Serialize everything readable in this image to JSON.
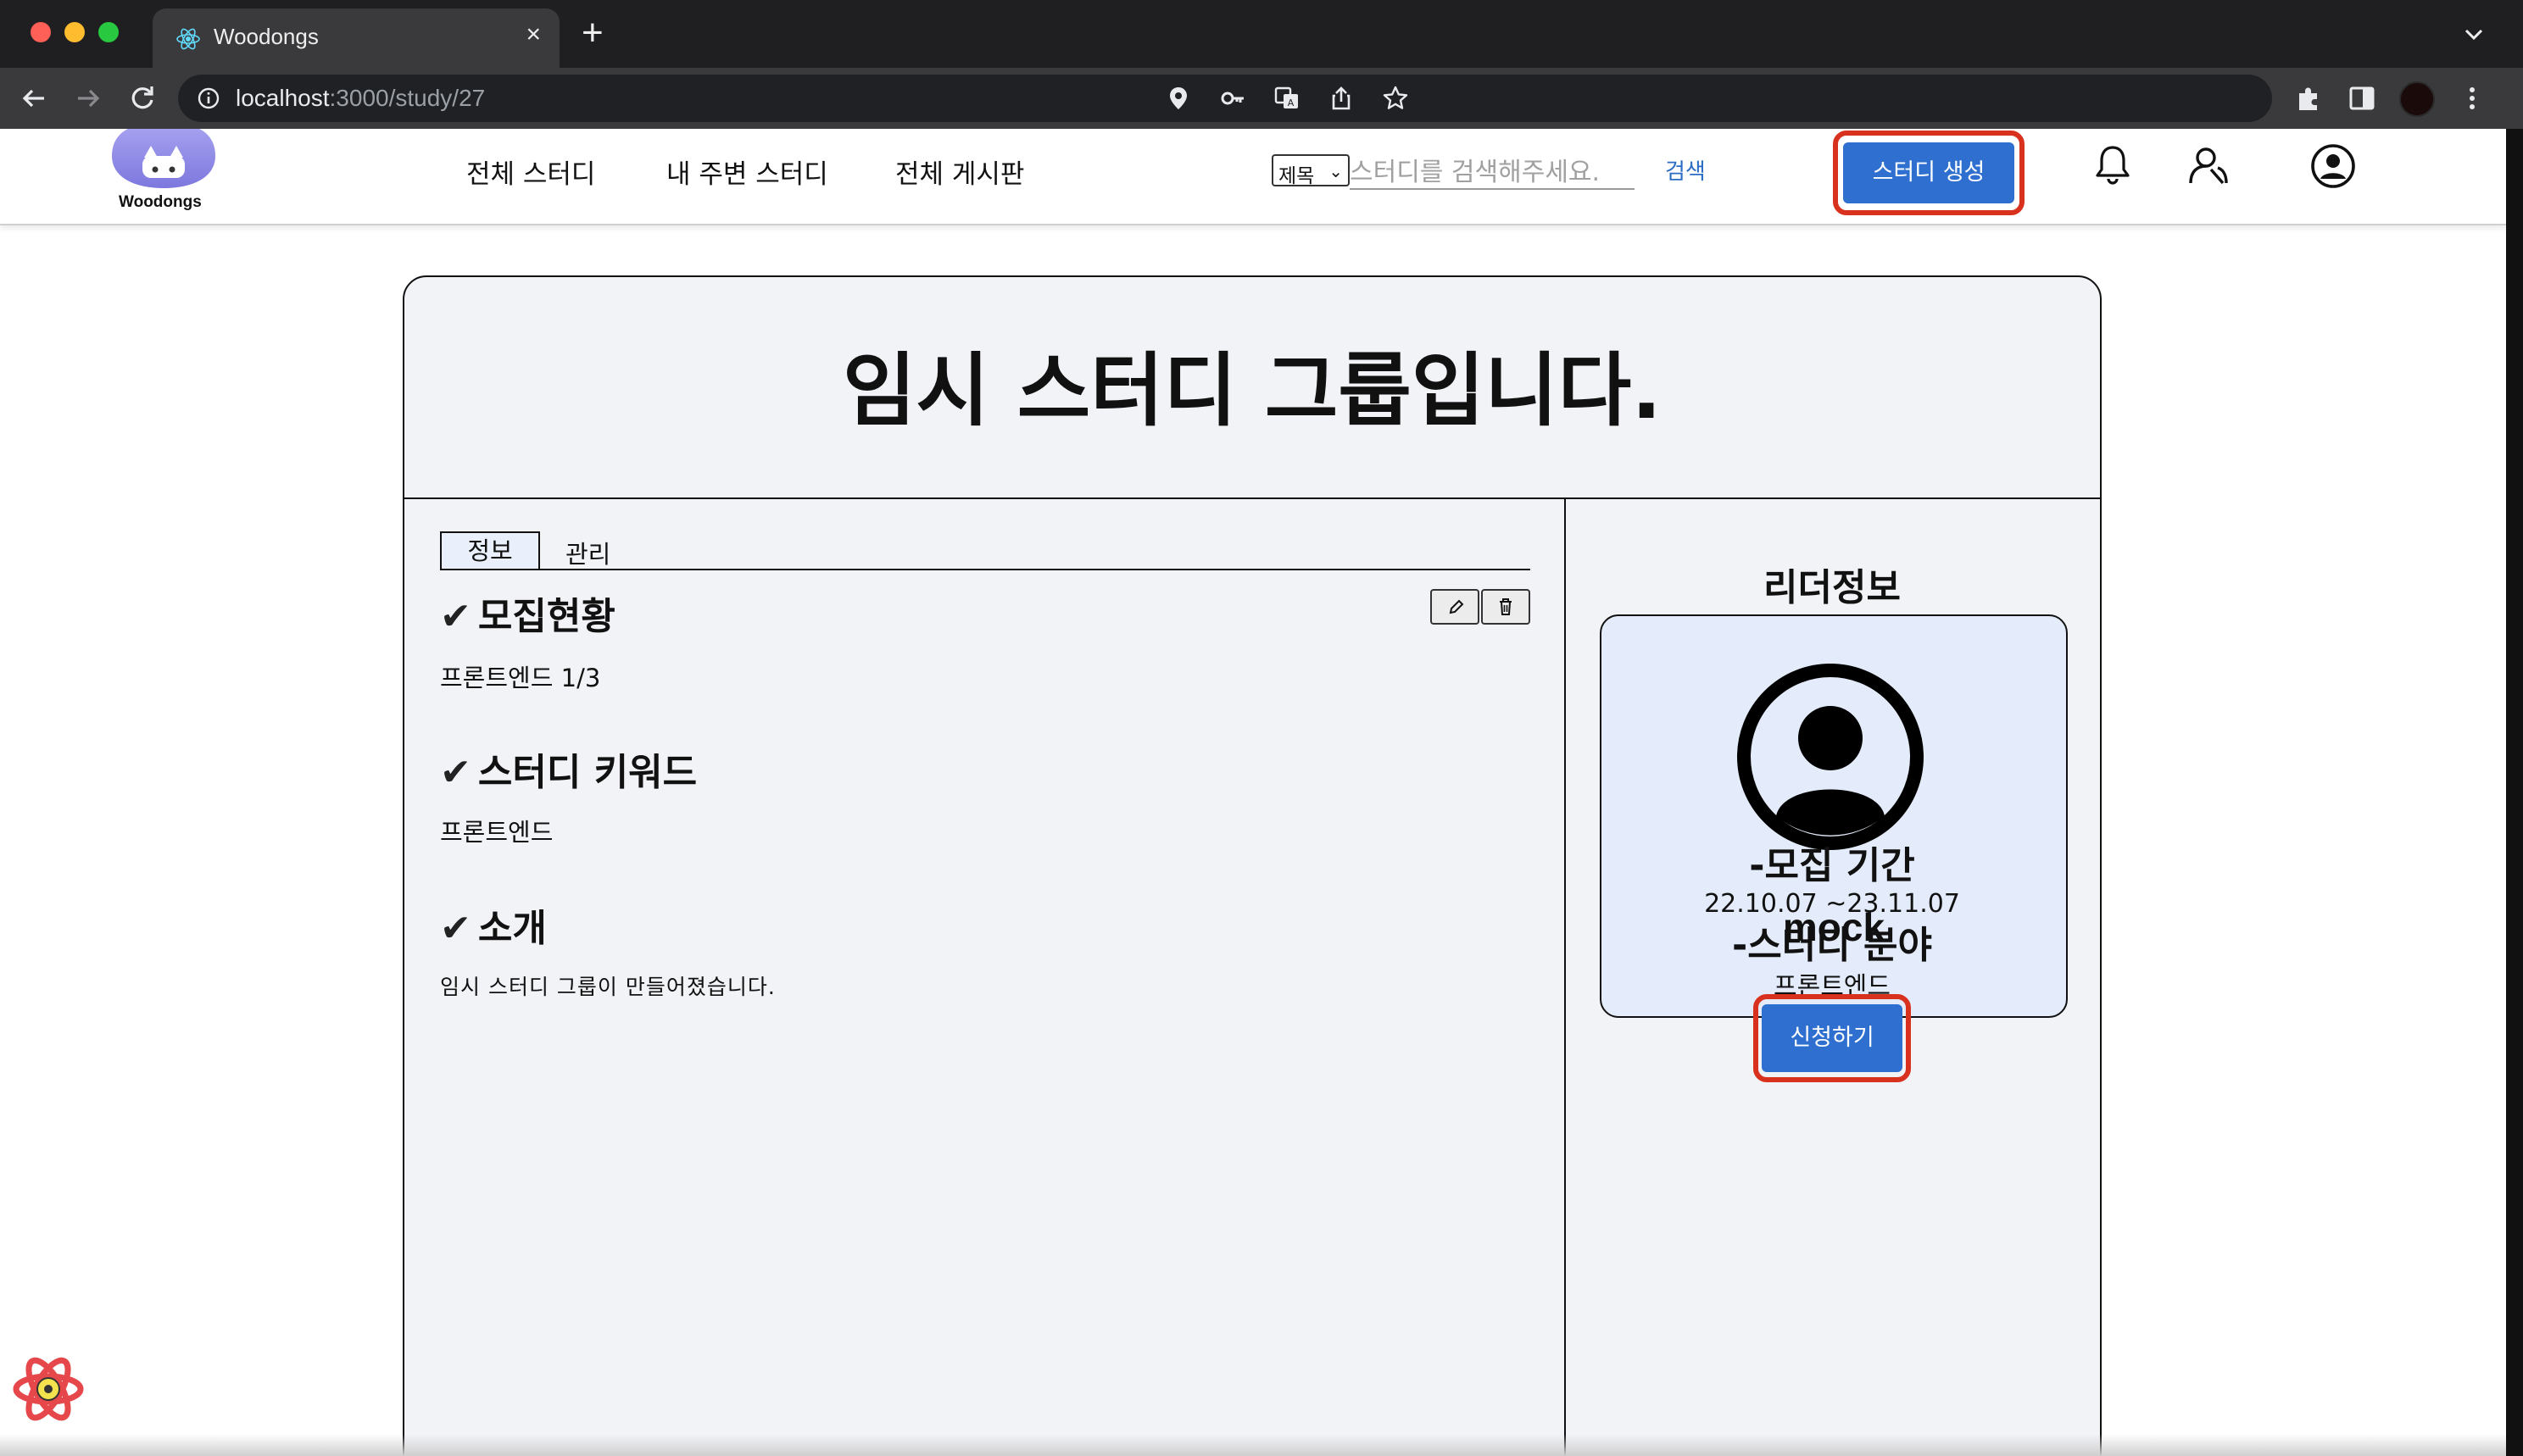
{
  "browser": {
    "tab_title": "Woodongs",
    "url_host": "localhost",
    "url_path": ":3000/study/27",
    "new_tab": "+",
    "close_tab": "×"
  },
  "header": {
    "logo_text": "Woodongs",
    "nav": [
      "전체 스터디",
      "내 주변 스터디",
      "전체 게시판"
    ],
    "search": {
      "select_value": "제목",
      "placeholder": "스터디를 검색해주세요.",
      "button": "검색"
    },
    "create_button": "스터디 생성"
  },
  "study": {
    "title": "임시 스터디 그룹입니다.",
    "tabs": [
      "정보",
      "관리"
    ],
    "sections": [
      {
        "heading": "모집현황",
        "body": "프론트엔드 1/3"
      },
      {
        "heading": "스터디 키워드",
        "body": "프론트엔드"
      },
      {
        "heading": "소개",
        "body": "임시 스터디 그룹이 만들어졌습니다."
      }
    ],
    "check_mark": "✔",
    "leader": {
      "heading": "리더정보",
      "name": "mock"
    },
    "period": {
      "heading": "-모집 기간",
      "value": "22.10.07 ~23.11.07"
    },
    "field": {
      "heading": "-스터디 분야",
      "value": "프론트엔드"
    },
    "apply_button": "신청하기"
  },
  "colors": {
    "primary_button": "#2e6fcf",
    "highlight_outline": "#d8321f",
    "card_bg": "#f2f3f7",
    "profile_bg": "#e4ecfb"
  }
}
